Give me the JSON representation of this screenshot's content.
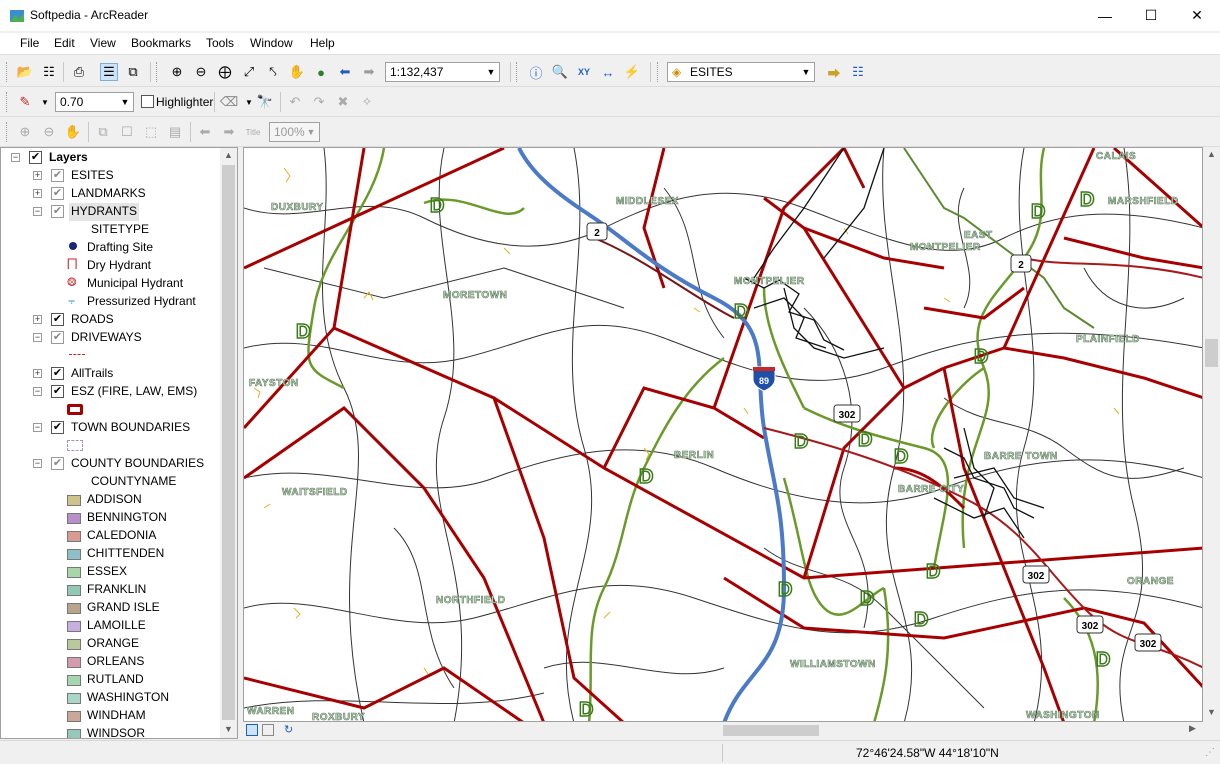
{
  "window": {
    "title": "Softpedia - ArcReader"
  },
  "menu": [
    "File",
    "Edit",
    "View",
    "Bookmarks",
    "Tools",
    "Window",
    "Help"
  ],
  "toolbar1": {
    "scale": "1:132,437",
    "layer_select": "ESITES"
  },
  "toolbar2": {
    "line_width": "0.70",
    "highlighter_label": "Highlighter"
  },
  "toolbar3": {
    "zoom_percent": "100%",
    "title_btn": "Title"
  },
  "toc": {
    "root": "Layers",
    "layers": [
      {
        "name": "ESITES",
        "checked": true
      },
      {
        "name": "LANDMARKS",
        "checked": true
      },
      {
        "name": "HYDRANTS",
        "checked": true
      },
      {
        "name": "SITETYPE"
      },
      {
        "name": "Drafting Site"
      },
      {
        "name": "Dry Hydrant"
      },
      {
        "name": "Municipal Hydrant"
      },
      {
        "name": "Pressurized Hydrant"
      },
      {
        "name": "ROADS",
        "checked": true
      },
      {
        "name": "DRIVEWAYS",
        "checked": true
      },
      {
        "name": "AllTrails",
        "checked": true
      },
      {
        "name": "ESZ (FIRE, LAW, EMS)",
        "checked": true
      },
      {
        "name": "TOWN BOUNDARIES",
        "checked": true
      },
      {
        "name": "COUNTY BOUNDARIES",
        "checked": true
      },
      {
        "name": "COUNTYNAME"
      }
    ],
    "counties": [
      {
        "name": "ADDISON",
        "color": "#cfc38c"
      },
      {
        "name": "BENNINGTON",
        "color": "#b98fc8"
      },
      {
        "name": "CALEDONIA",
        "color": "#d99a91"
      },
      {
        "name": "CHITTENDEN",
        "color": "#8fbfc9"
      },
      {
        "name": "ESSEX",
        "color": "#a8d6a8"
      },
      {
        "name": "FRANKLIN",
        "color": "#93c8b4"
      },
      {
        "name": "GRAND ISLE",
        "color": "#b9a48c"
      },
      {
        "name": "LAMOILLE",
        "color": "#c6aee0"
      },
      {
        "name": "ORANGE",
        "color": "#b9c99c"
      },
      {
        "name": "ORLEANS",
        "color": "#d49aae"
      },
      {
        "name": "RUTLAND",
        "color": "#a6d6b0"
      },
      {
        "name": "WASHINGTON",
        "color": "#a8d7c8"
      },
      {
        "name": "WINDHAM",
        "color": "#c8a896"
      },
      {
        "name": "WINDSOR",
        "color": "#96c8ba"
      }
    ]
  },
  "map": {
    "towns": [
      "DUXBURY",
      "MIDDLESEX",
      "CALAIS",
      "MARSHFIELD",
      "EAST",
      "MONTPELIER",
      "MORETOWN",
      "MONTPELIER",
      "PLAINFIELD",
      "FAYSTON",
      "BERLIN",
      "BARRE TOWN",
      "BARRE CITY",
      "WAITSFIELD",
      "NORTHFIELD",
      "ORANGE",
      "WILLIAMSTOWN",
      "WARREN",
      "ROXBURY",
      "WASHINGTON"
    ],
    "shields": [
      "2",
      "2",
      "89",
      "302",
      "302",
      "302",
      "302"
    ],
    "site_marker": "D"
  },
  "status": {
    "coords": "72°46'24.58\"W  44°18'10\"N"
  }
}
